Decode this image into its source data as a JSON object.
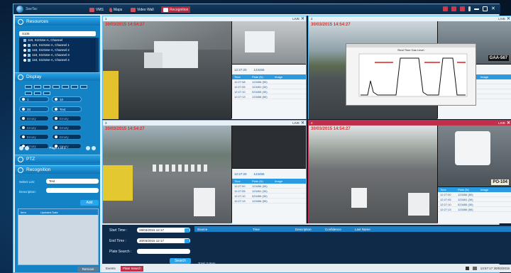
{
  "app": {
    "logo_text": "SeeTec"
  },
  "nav": [
    {
      "label": "VMS"
    },
    {
      "label": "Maps"
    },
    {
      "label": "Video Wall"
    },
    {
      "label": "Recognition"
    }
  ],
  "colors": {
    "accent": "#1483c6",
    "active": "#b8263b",
    "timestamp": "#e32b2b"
  },
  "sidebar": {
    "resources_title": "Resources",
    "search_value": "S106",
    "tree": [
      {
        "label": "118, S1016e-A, Channel"
      },
      {
        "label": "118, S1016e-A, Channel 1"
      },
      {
        "label": "118, S1016e-A, Channel 2"
      },
      {
        "label": "118, S1016e-A, Channel 3"
      },
      {
        "label": "118, S1016e-A, Channel 4"
      }
    ],
    "display_title": "Display",
    "display_buttons": [
      "1",
      "10",
      "20",
      "Text",
      "Emoty",
      "Emoty",
      "Emoty",
      "Emoty",
      "Emoty",
      "Emoty",
      "Emoty",
      "Emoty"
    ],
    "page_label": "Page 1 of 1",
    "ptz_title": "PTZ",
    "recognition_title": "Recognition",
    "select_list_label": "Select List:",
    "select_list_value": "Test",
    "description_label": "Description:",
    "add_label": "Add",
    "table_headers": [
      "Item",
      "Updated Date"
    ],
    "remove_label": "Remove"
  },
  "panes": [
    {
      "num": "1",
      "live": "LIVE",
      "timestamp": "30/03/2015 14:54:27",
      "time": "12:27:20",
      "plate": "123455",
      "headers": [
        "Time",
        "Plate (N)",
        "Image"
      ],
      "rows": [
        [
          "12:27:08",
          "123456 (50)"
        ],
        [
          "12:27:05",
          "123451 (30)"
        ],
        [
          "12:27:10",
          "023455 (30)"
        ],
        [
          "12:27:13",
          "123456 (50)"
        ]
      ]
    },
    {
      "num": "2",
      "live": "LIVE",
      "timestamp": "30/03/2015 14:54:27",
      "time": "12:27:20",
      "plate": "123455",
      "headers": [
        "Time",
        "Plate (N)",
        "Image"
      ],
      "rows": [
        [
          "12:27:00",
          "123456 (50)"
        ],
        [
          "12:27:05",
          "123451 (30)"
        ],
        [
          "12:27:10",
          "023455 (30)"
        ],
        [
          "12:27:13",
          "123456 (50)"
        ]
      ],
      "overlay_title": "Real Time Gas Level"
    },
    {
      "num": "3",
      "live": "LIVE",
      "timestamp": "30/03/2015 14:54:27",
      "time": "12:27:20",
      "plate": "123455",
      "headers": [
        "Time",
        "Plate (N)",
        "Image"
      ],
      "rows": [
        [
          "12:27:00",
          "123456 (50)"
        ],
        [
          "12:27:05",
          "123451 (30)"
        ],
        [
          "12:27:10",
          "023455 (30)"
        ],
        [
          "12:27:13",
          "123456 (50)"
        ]
      ]
    },
    {
      "num": "4",
      "live": "LIVE",
      "timestamp": "30/03/2015 14:54:27",
      "time": "12:27:20",
      "plate": "123455",
      "headers": [
        "Time",
        "Plate (N)",
        "Image"
      ],
      "rows": [
        [
          "12:27:00",
          "123456 (50)"
        ],
        [
          "12:27:05",
          "123451 (30)"
        ],
        [
          "12:27:10",
          "023455 (30)"
        ],
        [
          "12:27:13",
          "123456 (50)"
        ]
      ]
    }
  ],
  "plates": {
    "p2": "GAA-567",
    "p4": "PO-104"
  },
  "search_panel": {
    "start_label": "Start Time :",
    "start_value": "28/03/2015 12:17",
    "end_label": "End Time :",
    "end_value": "30/03/2015 12:17",
    "plate_label": "Plate Search :",
    "search_label": "Search",
    "columns": [
      "Source",
      "Time",
      "Description",
      "Confidence",
      "Last Name"
    ],
    "total": "Total: 0 Item"
  },
  "footer": {
    "tabs": [
      "Events",
      "Plate Search"
    ],
    "clock": "13:57:17 30/03/2015"
  }
}
